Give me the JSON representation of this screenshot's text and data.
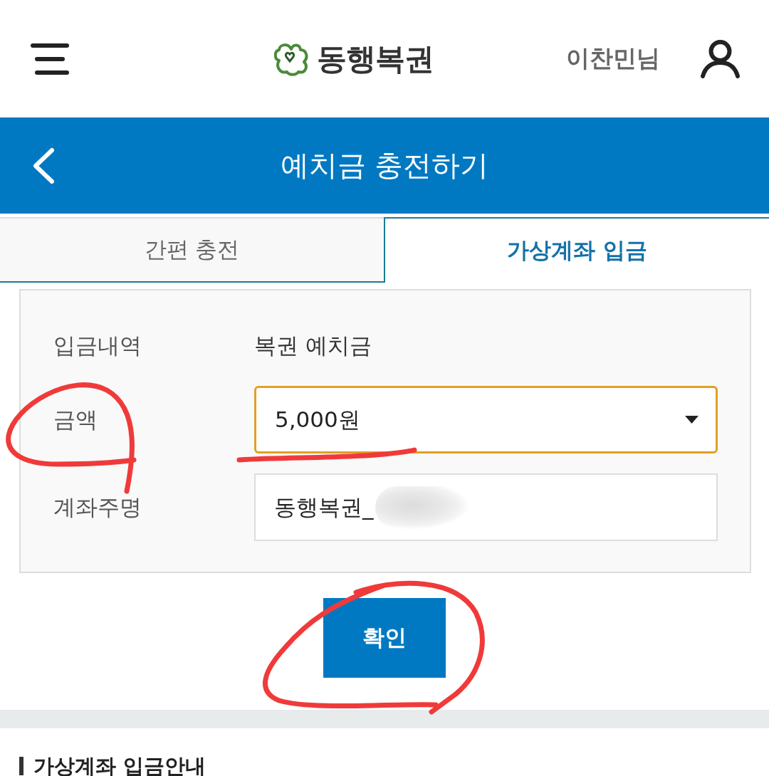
{
  "header": {
    "logo": {
      "text": "동행복권"
    },
    "user": {
      "name": "이찬민님"
    }
  },
  "title_bar": {
    "title": "예치금 충전하기"
  },
  "tabs": [
    {
      "label": "간편 충전",
      "selected": false
    },
    {
      "label": "가상계좌 입금",
      "selected": true
    }
  ],
  "form": {
    "rows": [
      {
        "kind": "text",
        "label": "입금내역",
        "value": "복권 예치금"
      },
      {
        "kind": "select",
        "label": "금액",
        "value": "5,000원",
        "focused": true
      },
      {
        "kind": "input",
        "label": "계좌주명",
        "value": "동행복권_",
        "redacted": true
      }
    ]
  },
  "confirm_button": {
    "label": "확인"
  },
  "section": {
    "title": "가상계좌 입금안내"
  }
}
